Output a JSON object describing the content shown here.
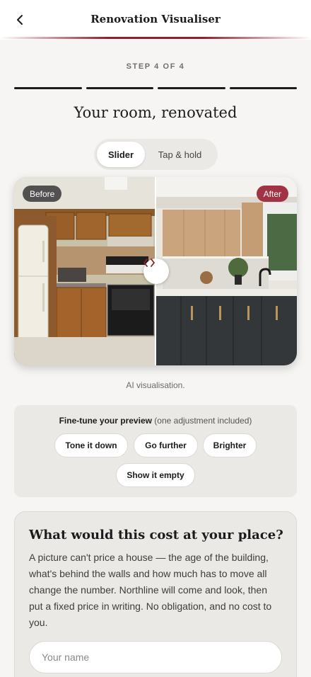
{
  "header": {
    "title": "Renovation Visualiser",
    "back_icon": "chevron-left-icon"
  },
  "step": {
    "label": "STEP 4 OF 4",
    "current": 4,
    "total": 4
  },
  "page_title": "Your room, renovated",
  "view_toggle": {
    "options": [
      "Slider",
      "Tap & hold"
    ],
    "selected": "Slider"
  },
  "compare": {
    "before_label": "Before",
    "after_label": "After",
    "handle_icon": "code-arrows-icon",
    "slider_position": 0.5
  },
  "caption": "AI visualisation.",
  "finetune": {
    "title": "Fine-tune your preview",
    "note": "(one adjustment included)",
    "options": [
      "Tone it down",
      "Go further",
      "Brighter",
      "Show it empty"
    ]
  },
  "cost": {
    "title": "What would this cost at your place?",
    "body": "A picture can't price a house — the age of the building, what's behind the walls and how much has to move all change the number. Northline will come and look, then put a fixed price in writing. No obligation, and no cost to you.",
    "name_placeholder": "Your name"
  },
  "colors": {
    "accent": "#8b1f2f",
    "after_badge": "#a23344",
    "background": "#f6f5f3"
  }
}
